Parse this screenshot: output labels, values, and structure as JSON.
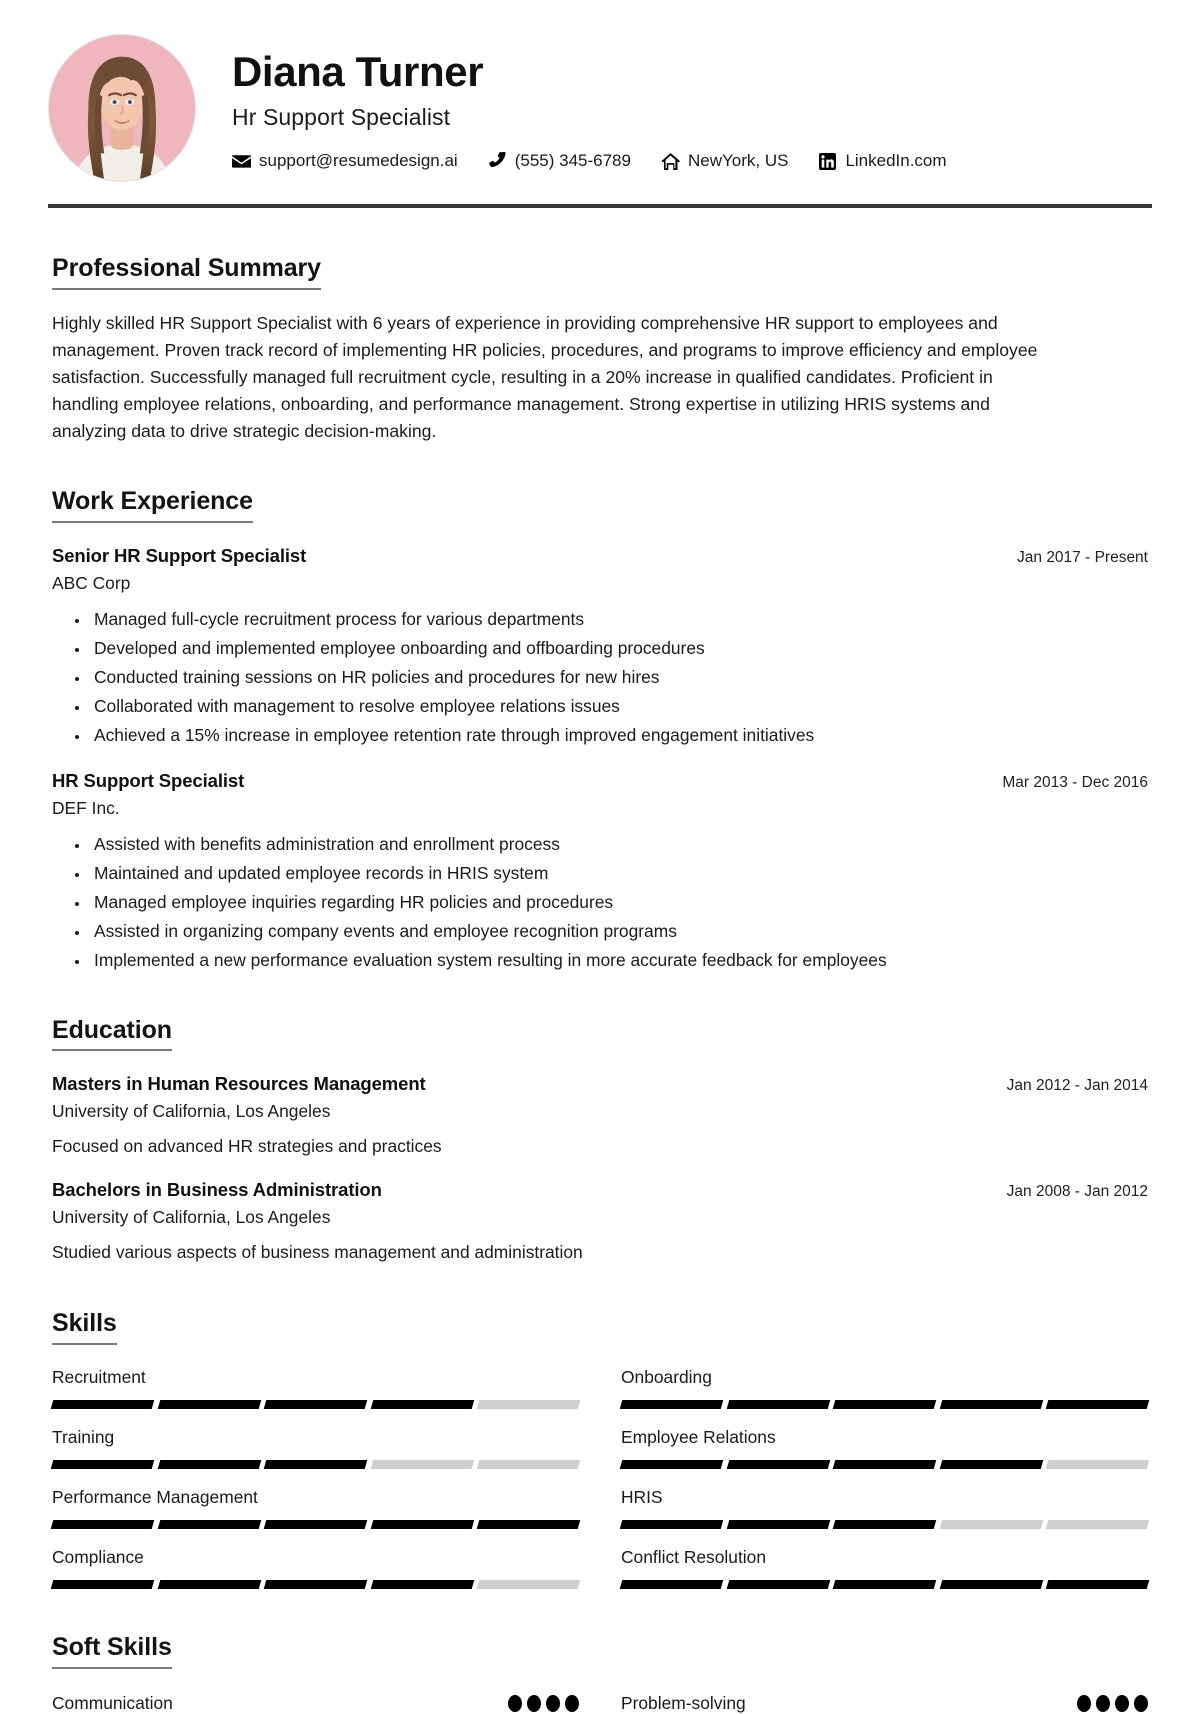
{
  "header": {
    "name": "Diana Turner",
    "role": "Hr Support Specialist",
    "avatar_alt": "profile-photo",
    "avatar_bg": "#efb6bd",
    "contacts": [
      {
        "icon": "envelope-icon",
        "text": "support@resumedesign.ai"
      },
      {
        "icon": "phone-icon",
        "text": "(555) 345-6789"
      },
      {
        "icon": "home-icon",
        "text": "NewYork, US"
      },
      {
        "icon": "linkedin-icon",
        "text": "LinkedIn.com"
      }
    ]
  },
  "summary": {
    "title": "Professional Summary",
    "text": "Highly skilled HR Support Specialist with 6 years of experience in providing comprehensive HR support to employees and management. Proven track record of implementing HR policies, procedures, and programs to improve efficiency and employee satisfaction. Successfully managed full recruitment cycle, resulting in a 20% increase in qualified candidates. Proficient in handling employee relations, onboarding, and performance management. Strong expertise in utilizing HRIS systems and analyzing data to drive strategic decision-making."
  },
  "work": {
    "title": "Work Experience",
    "entries": [
      {
        "job_title": "Senior HR Support Specialist",
        "company": "ABC Corp",
        "date": "Jan 2017 - Present",
        "bullets": [
          "Managed full-cycle recruitment process for various departments",
          "Developed and implemented employee onboarding and offboarding procedures",
          "Conducted training sessions on HR policies and procedures for new hires",
          "Collaborated with management to resolve employee relations issues",
          "Achieved a 15% increase in employee retention rate through improved engagement initiatives"
        ]
      },
      {
        "job_title": "HR Support Specialist",
        "company": "DEF Inc.",
        "date": "Mar 2013 - Dec 2016",
        "bullets": [
          "Assisted with benefits administration and enrollment process",
          "Maintained and updated employee records in HRIS system",
          "Managed employee inquiries regarding HR policies and procedures",
          "Assisted in organizing company events and employee recognition programs",
          "Implemented a new performance evaluation system resulting in more accurate feedback for employees"
        ]
      }
    ]
  },
  "education": {
    "title": "Education",
    "entries": [
      {
        "degree": "Masters in Human Resources Management",
        "school": "University of California, Los Angeles",
        "date": "Jan 2012 - Jan 2014",
        "note": "Focused on advanced HR strategies and practices"
      },
      {
        "degree": "Bachelors in Business Administration",
        "school": "University of California, Los Angeles",
        "date": "Jan 2008 - Jan 2012",
        "note": "Studied various aspects of business management and administration"
      }
    ]
  },
  "skills": {
    "title": "Skills",
    "max_level": 5,
    "items": [
      {
        "name": "Recruitment",
        "level": 4
      },
      {
        "name": "Onboarding",
        "level": 5
      },
      {
        "name": "Training",
        "level": 3
      },
      {
        "name": "Employee Relations",
        "level": 4
      },
      {
        "name": "Performance Management",
        "level": 5
      },
      {
        "name": "HRIS",
        "level": 3
      },
      {
        "name": "Compliance",
        "level": 4
      },
      {
        "name": "Conflict Resolution",
        "level": 5
      }
    ]
  },
  "soft_skills": {
    "title": "Soft Skills",
    "max_level": 5,
    "items": [
      {
        "name": "Communication",
        "level": 4
      },
      {
        "name": "Problem-solving",
        "level": 4
      }
    ]
  },
  "colors": {
    "accent_pink": "#efb6bd",
    "rule": "#3a3a3a",
    "bar_on": "#000000",
    "bar_off": "#cfcfcf"
  }
}
